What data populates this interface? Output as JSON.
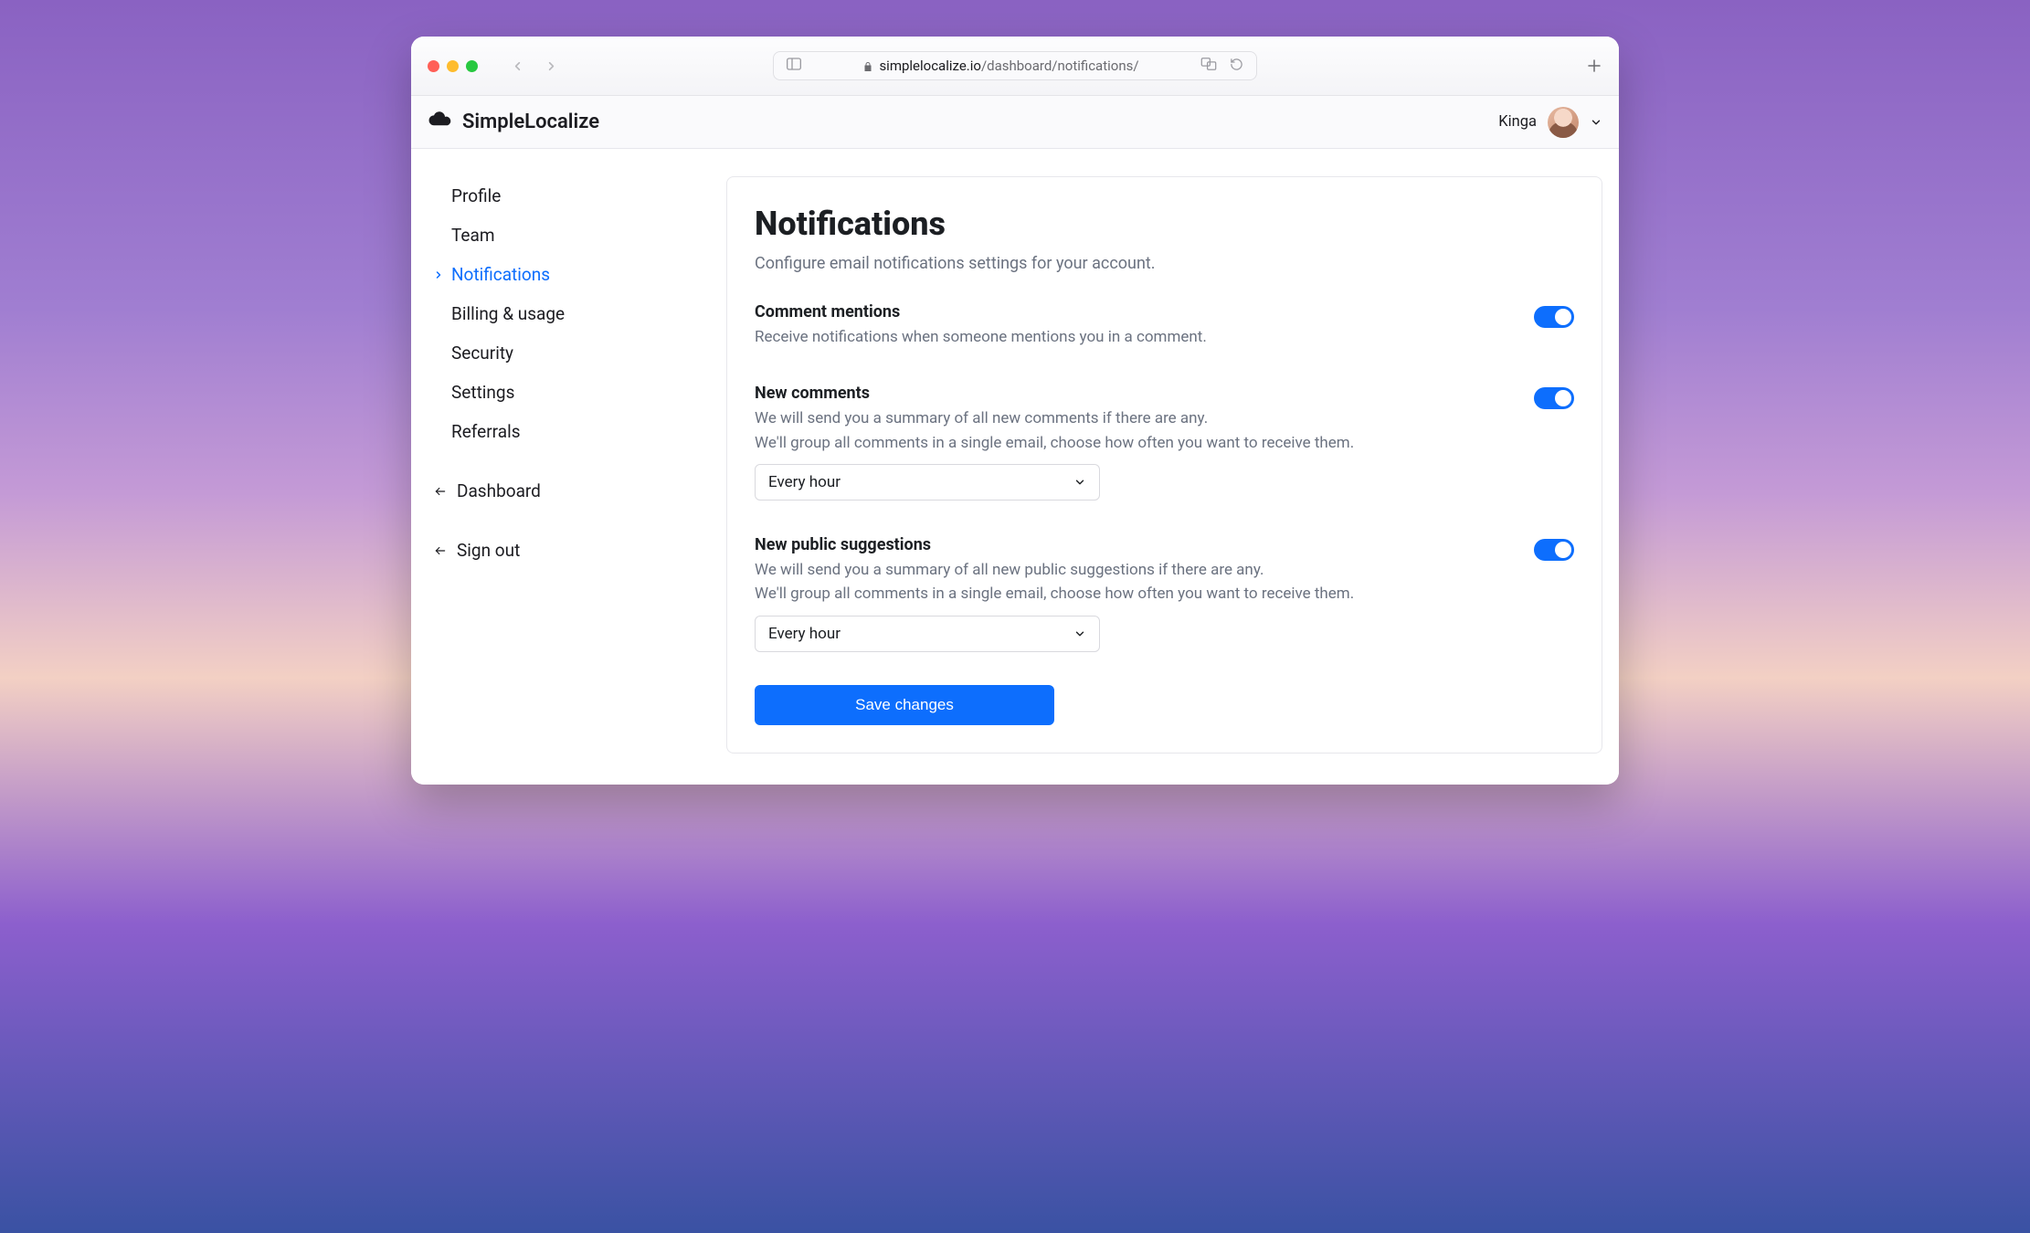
{
  "browser": {
    "url_domain": "simplelocalize.io",
    "url_path": "/dashboard/notifications/"
  },
  "header": {
    "brand": "SimpleLocalize",
    "user_name": "Kinga"
  },
  "sidebar": {
    "items": [
      {
        "label": "Profile",
        "active": false
      },
      {
        "label": "Team",
        "active": false
      },
      {
        "label": "Notifications",
        "active": true
      },
      {
        "label": "Billing & usage",
        "active": false
      },
      {
        "label": "Security",
        "active": false
      },
      {
        "label": "Settings",
        "active": false
      },
      {
        "label": "Referrals",
        "active": false
      }
    ],
    "dashboard_label": "Dashboard",
    "signout_label": "Sign out"
  },
  "page": {
    "title": "Notifications",
    "subtitle": "Configure email notifications settings for your account.",
    "settings": {
      "mentions": {
        "title": "Comment mentions",
        "desc": "Receive notifications when someone mentions you in a comment.",
        "enabled": true
      },
      "new_comments": {
        "title": "New comments",
        "desc_line1": "We will send you a summary of all new comments if there are any.",
        "desc_line2": "We'll group all comments in a single email, choose how often you want to receive them.",
        "enabled": true,
        "frequency": "Every hour"
      },
      "public_suggestions": {
        "title": "New public suggestions",
        "desc_line1": "We will send you a summary of all new public suggestions if there are any.",
        "desc_line2": "We'll group all comments in a single email, choose how often you want to receive them.",
        "enabled": true,
        "frequency": "Every hour"
      }
    },
    "save_label": "Save changes"
  }
}
